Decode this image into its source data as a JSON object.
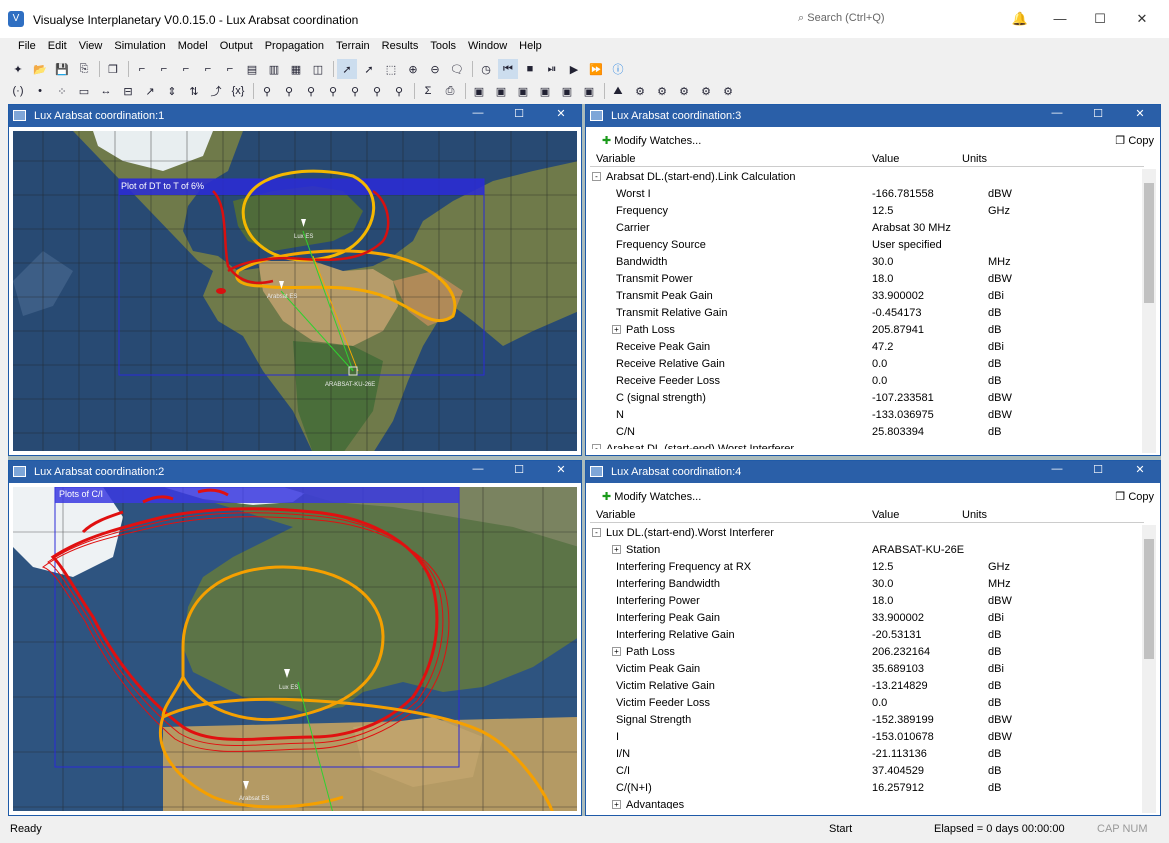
{
  "app": {
    "title": "Visualyse Interplanetary V0.0.15.0 - Lux Arabsat coordination",
    "search": "Search (Ctrl+Q)"
  },
  "menu": [
    "File",
    "Edit",
    "View",
    "Simulation",
    "Model",
    "Output",
    "Propagation",
    "Terrain",
    "Results",
    "Tools",
    "Window",
    "Help"
  ],
  "panes": {
    "p1": {
      "title": "Lux Arabsat coordination:1",
      "plot_label": "Plot of DT to T of 6%",
      "stations": [
        "Lux ES",
        "Arabsat ES",
        "ARABSAT-KU-26E"
      ]
    },
    "p2": {
      "title": "Lux Arabsat coordination:2",
      "plot_label": "Plots of C/I",
      "stations": [
        "Lux ES",
        "Arabsat ES"
      ]
    },
    "p3": {
      "title": "Lux Arabsat coordination:3",
      "modify": "Modify Watches...",
      "copy": "Copy",
      "cols": {
        "variable": "Variable",
        "value": "Value",
        "units": "Units"
      },
      "rows": [
        {
          "v": "Arabsat DL.(start-end).Link Calculation",
          "val": "",
          "u": "",
          "lvl": 0,
          "exp": "-"
        },
        {
          "v": "Worst I",
          "val": "-166.781558",
          "u": "dBW",
          "lvl": 1
        },
        {
          "v": "Frequency",
          "val": "12.5",
          "u": "GHz",
          "lvl": 1
        },
        {
          "v": "Carrier",
          "val": "Arabsat 30 MHz",
          "u": "",
          "lvl": 1
        },
        {
          "v": "Frequency Source",
          "val": "User specified",
          "u": "",
          "lvl": 1
        },
        {
          "v": "Bandwidth",
          "val": "30.0",
          "u": "MHz",
          "lvl": 1
        },
        {
          "v": "Transmit Power",
          "val": "18.0",
          "u": "dBW",
          "lvl": 1
        },
        {
          "v": "Transmit Peak Gain",
          "val": "33.900002",
          "u": "dBi",
          "lvl": 1
        },
        {
          "v": "Transmit Relative Gain",
          "val": "-0.454173",
          "u": "dB",
          "lvl": 1
        },
        {
          "v": "Path Loss",
          "val": "205.87941",
          "u": "dB",
          "lvl": 1,
          "exp": "+"
        },
        {
          "v": "Receive Peak Gain",
          "val": "47.2",
          "u": "dBi",
          "lvl": 1
        },
        {
          "v": "Receive Relative Gain",
          "val": "0.0",
          "u": "dB",
          "lvl": 1
        },
        {
          "v": "Receive Feeder Loss",
          "val": "0.0",
          "u": "dB",
          "lvl": 1
        },
        {
          "v": "C (signal strength)",
          "val": "-107.233581",
          "u": "dBW",
          "lvl": 1
        },
        {
          "v": "N",
          "val": "-133.036975",
          "u": "dBW",
          "lvl": 1
        },
        {
          "v": "C/N",
          "val": "25.803394",
          "u": "dB",
          "lvl": 1
        },
        {
          "v": "Arabsat DL.(start-end).Worst Interferer",
          "val": "",
          "u": "",
          "lvl": 0,
          "exp": "-"
        }
      ]
    },
    "p4": {
      "title": "Lux Arabsat coordination:4",
      "modify": "Modify Watches...",
      "copy": "Copy",
      "cols": {
        "variable": "Variable",
        "value": "Value",
        "units": "Units"
      },
      "rows": [
        {
          "v": "Lux DL.(start-end).Worst Interferer",
          "val": "",
          "u": "",
          "lvl": 0,
          "exp": "-"
        },
        {
          "v": "Station",
          "val": "ARABSAT-KU-26E",
          "u": "",
          "lvl": 1,
          "exp": "+"
        },
        {
          "v": "Interfering Frequency at RX",
          "val": "12.5",
          "u": "GHz",
          "lvl": 1
        },
        {
          "v": "Interfering Bandwidth",
          "val": "30.0",
          "u": "MHz",
          "lvl": 1
        },
        {
          "v": "Interfering Power",
          "val": "18.0",
          "u": "dBW",
          "lvl": 1
        },
        {
          "v": "Interfering Peak Gain",
          "val": "33.900002",
          "u": "dBi",
          "lvl": 1
        },
        {
          "v": "Interfering Relative Gain",
          "val": "-20.53131",
          "u": "dB",
          "lvl": 1
        },
        {
          "v": "Path Loss",
          "val": "206.232164",
          "u": "dB",
          "lvl": 1,
          "exp": "+"
        },
        {
          "v": "Victim Peak Gain",
          "val": "35.689103",
          "u": "dBi",
          "lvl": 1
        },
        {
          "v": "Victim Relative Gain",
          "val": "-13.214829",
          "u": "dB",
          "lvl": 1
        },
        {
          "v": "Victim Feeder Loss",
          "val": "0.0",
          "u": "dB",
          "lvl": 1
        },
        {
          "v": "Signal Strength",
          "val": "-152.389199",
          "u": "dBW",
          "lvl": 1
        },
        {
          "v": "I",
          "val": "-153.010678",
          "u": "dBW",
          "lvl": 1
        },
        {
          "v": "I/N",
          "val": "-21.113136",
          "u": "dB",
          "lvl": 1
        },
        {
          "v": "C/I",
          "val": "37.404529",
          "u": "dB",
          "lvl": 1
        },
        {
          "v": "C/(N+I)",
          "val": "16.257912",
          "u": "dB",
          "lvl": 1
        },
        {
          "v": "Advantages",
          "val": "",
          "u": "",
          "lvl": 1,
          "exp": "+"
        }
      ]
    }
  },
  "status": {
    "left": "Ready",
    "mid": "Start",
    "elapsed": "Elapsed = 0 days 00:00:00",
    "caps": "CAP NUM"
  },
  "colors": {
    "accent": "#2a5fa8",
    "contour_red": "#e01010",
    "contour_orange": "#f5a000",
    "link_green": "#30d030"
  }
}
